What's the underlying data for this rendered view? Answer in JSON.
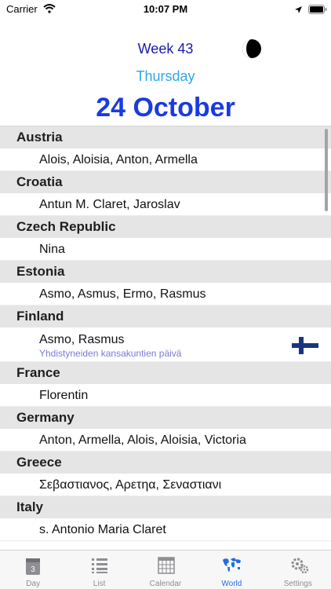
{
  "status_bar": {
    "carrier": "Carrier",
    "time": "10:07 PM"
  },
  "header": {
    "week": "Week 43",
    "weekday": "Thursday",
    "date": "24 October"
  },
  "countries": [
    {
      "name": "Austria",
      "names": "Alois, Aloisia, Anton, Armella"
    },
    {
      "name": "Croatia",
      "names": "Antun M. Claret, Jaroslav"
    },
    {
      "name": "Czech Republic",
      "names": "Nina"
    },
    {
      "name": "Estonia",
      "names": "Asmo, Asmus, Ermo, Rasmus"
    },
    {
      "name": "Finland",
      "names": "Asmo, Rasmus",
      "note": "Yhdistyneiden kansakuntien päivä"
    },
    {
      "name": "France",
      "names": "Florentin"
    },
    {
      "name": "Germany",
      "names": "Anton, Armella, Alois, Aloisia, Victoria"
    },
    {
      "name": "Greece",
      "names": "Σεβαστιανος, Αρετηα, Σεναστιανι"
    },
    {
      "name": "Italy",
      "names": "s. Antonio Maria Claret"
    }
  ],
  "tabs": [
    {
      "label": "Day",
      "icon": "calendar-day-icon"
    },
    {
      "label": "List",
      "icon": "list-icon"
    },
    {
      "label": "Calendar",
      "icon": "calendar-grid-icon"
    },
    {
      "label": "World",
      "icon": "world-map-icon",
      "active": true
    },
    {
      "label": "Settings",
      "icon": "gear-icon"
    }
  ],
  "colors": {
    "accent": "#1a3be0",
    "week": "#1a1aa8",
    "weekday": "#2fa6e8",
    "tab_active": "#1f6fe0",
    "note": "#7a7ad8",
    "flag_cross": "#18357f"
  }
}
